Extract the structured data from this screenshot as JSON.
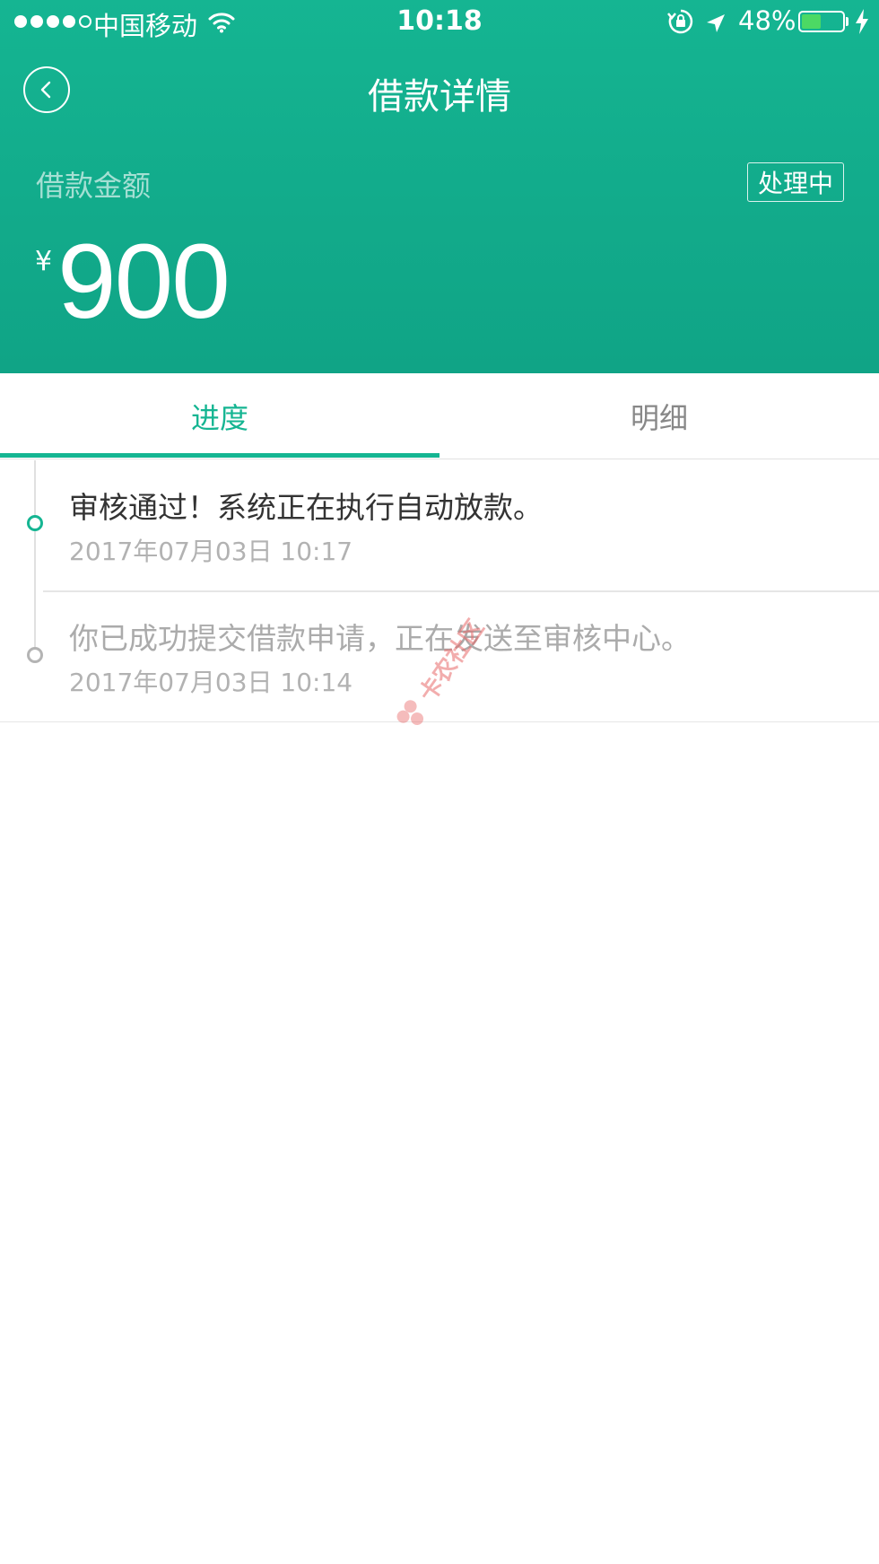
{
  "status_bar": {
    "carrier": "中国移动",
    "time": "10:18",
    "battery_percent": "48%",
    "battery_level": 0.48,
    "signal_bars_filled": 4,
    "signal_bars_total": 5
  },
  "nav": {
    "title": "借款详情"
  },
  "loan": {
    "amount_label": "借款金额",
    "status": "处理中",
    "currency_symbol": "¥",
    "amount": "900"
  },
  "tabs": [
    {
      "label": "进度",
      "active": true
    },
    {
      "label": "明细",
      "active": false
    }
  ],
  "timeline": [
    {
      "title": "审核通过！系统正在执行自动放款。",
      "time": "2017年07月03日 10:17",
      "active": true
    },
    {
      "title": "你已成功提交借款申请，正在发送至审核中心。",
      "time": "2017年07月03日 10:14",
      "active": false
    }
  ],
  "watermark": "卡农社区",
  "colors": {
    "brand": "#15b592",
    "inactive_text": "#ababab",
    "battery_fill": "#4cd964"
  }
}
